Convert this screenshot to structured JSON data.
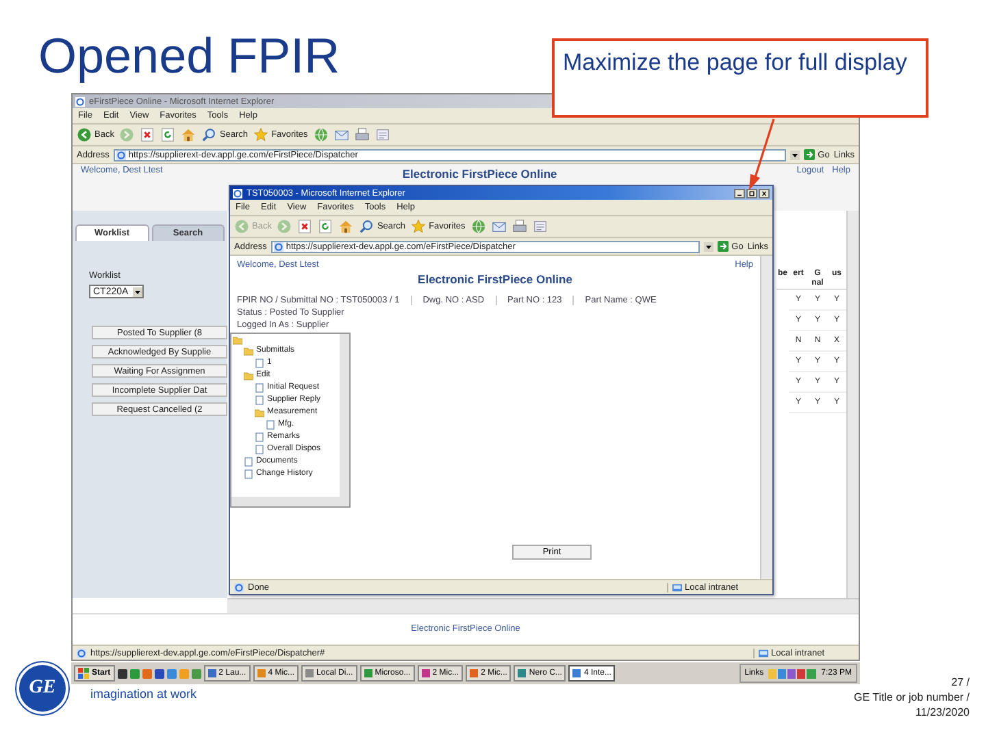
{
  "slide": {
    "title": "Opened FPIR",
    "callout": "Maximize the page for full display",
    "logo": "GE",
    "tagline": "imagination at work",
    "page_number": "27 /",
    "footer_title": "GE Title or job number /",
    "date": "11/23/2020"
  },
  "browser": {
    "title": "eFirstPiece Online - Microsoft Internet Explorer",
    "active": false,
    "menu": [
      "File",
      "Edit",
      "View",
      "Favorites",
      "Tools",
      "Help"
    ],
    "toolbar": [
      {
        "kind": "back",
        "label": "Back",
        "disabled": false
      },
      {
        "kind": "forward",
        "disabled": true
      },
      {
        "kind": "stop",
        "disabled": false
      },
      {
        "kind": "refresh",
        "disabled": false
      },
      {
        "kind": "home",
        "disabled": false
      },
      {
        "kind": "search",
        "label": "Search",
        "disabled": false
      },
      {
        "kind": "favorites",
        "label": "Favorites",
        "disabled": false
      },
      {
        "kind": "media",
        "disabled": false
      },
      {
        "kind": "mail",
        "disabled": false
      },
      {
        "kind": "print",
        "disabled": false
      },
      {
        "kind": "edit",
        "disabled": false
      }
    ],
    "address_label": "Address",
    "url": "https://supplierext-dev.appl.ge.com/eFirstPiece/Dispatcher",
    "go": "Go",
    "links": "Links",
    "page": {
      "welcome": "Welcome, Dest Ltest",
      "heading": "Electronic FirstPiece Online",
      "top_links": [
        "Logout",
        "Help"
      ],
      "tabs": [
        {
          "label": "Worklist",
          "selected": true
        },
        {
          "label": "Search",
          "selected": false
        }
      ],
      "worklist_label": "Worklist",
      "worklist_value": "CT220A",
      "queue_buttons": [
        "Posted To Supplier (8",
        "Acknowledged By Supplie",
        "Waiting For Assignmen",
        "Incomplete Supplier Dat",
        "Request Cancelled (2"
      ],
      "table": {
        "columns": [
          "be",
          "ert",
          "G nal",
          "us"
        ],
        "rows": [
          [
            "",
            "Y",
            "Y",
            "Y"
          ],
          [
            "",
            "Y",
            "Y",
            "Y"
          ],
          [
            "",
            "N",
            "N",
            "X"
          ],
          [
            "",
            "Y",
            "Y",
            "Y"
          ],
          [
            "",
            "Y",
            "Y",
            "Y"
          ],
          [
            "",
            "Y",
            "Y",
            "Y"
          ]
        ]
      },
      "footer": "Electronic FirstPiece Online"
    },
    "status_bar": {
      "url": "https://supplierext-dev.appl.ge.com/eFirstPiece/Dispatcher#",
      "zone": "Local intranet"
    }
  },
  "popup": {
    "title": "TST050003 - Microsoft Internet Explorer",
    "active": true,
    "menu": [
      "File",
      "Edit",
      "View",
      "Favorites",
      "Tools",
      "Help"
    ],
    "toolbar": [
      {
        "kind": "back",
        "label": "Back",
        "disabled": true
      },
      {
        "kind": "forward",
        "disabled": true
      },
      {
        "kind": "stop",
        "disabled": false
      },
      {
        "kind": "refresh",
        "disabled": false
      },
      {
        "kind": "home",
        "disabled": false
      },
      {
        "kind": "search",
        "label": "Search",
        "disabled": false
      },
      {
        "kind": "favorites",
        "label": "Favorites",
        "disabled": false
      },
      {
        "kind": "media",
        "disabled": false
      },
      {
        "kind": "mail",
        "disabled": false
      },
      {
        "kind": "print",
        "disabled": false
      },
      {
        "kind": "edit",
        "disabled": false
      }
    ],
    "address_label": "Address",
    "url": "https://supplierext-dev.appl.ge.com/eFirstPiece/Dispatcher",
    "go": "Go",
    "links": "Links",
    "page": {
      "welcome": "Welcome, Dest Ltest",
      "help": "Help",
      "heading": "Electronic FirstPiece Online",
      "info": [
        "FPIR NO / Submittal NO : TST050003 / 1",
        "Dwg. NO : ASD",
        "Part NO : 123",
        "Part Name : QWE"
      ],
      "status": "Status : Posted To Supplier",
      "logged_in": "Logged In As : Supplier",
      "tree": {
        "children": [
          {
            "label": "Submittals",
            "children": [
              {
                "label": "1"
              }
            ]
          },
          {
            "label": "Edit",
            "children": [
              {
                "label": "Initial Request"
              },
              {
                "label": "Supplier Reply"
              },
              {
                "label": "Measurement",
                "children": [
                  {
                    "label": "Mfg."
                  }
                ]
              },
              {
                "label": "Remarks"
              },
              {
                "label": "Overall Dispos"
              }
            ]
          },
          {
            "label": "Documents"
          },
          {
            "label": "Change History"
          }
        ]
      },
      "print": "Print"
    },
    "status_bar": {
      "text": "Done",
      "zone": "Local intranet"
    }
  },
  "taskbar": {
    "start": "Start",
    "tasks": [
      {
        "label": "2 Lau...",
        "color": "#3b6fc4",
        "selected": false
      },
      {
        "label": "4 Mic...",
        "color": "#e08a1e",
        "selected": false
      },
      {
        "label": "Local Di...",
        "color": "#8a8a8a",
        "selected": false
      },
      {
        "label": "Microso...",
        "color": "#2e9a3e",
        "selected": false
      },
      {
        "label": "2 Mic...",
        "color": "#c2338a",
        "selected": false
      },
      {
        "label": "2 Mic...",
        "color": "#e0641e",
        "selected": false
      },
      {
        "label": "Nero C...",
        "color": "#2a8a8a",
        "selected": false
      },
      {
        "label": "4 Inte...",
        "color": "#3b7fd4",
        "selected": true
      }
    ],
    "links": "Links",
    "clock": "7:23 PM"
  }
}
